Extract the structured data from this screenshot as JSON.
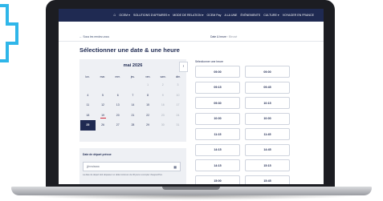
{
  "top_nav": {
    "home_icon": "home-icon",
    "items": [
      {
        "label": "OCEM ▾"
      },
      {
        "label": "SOLUTIONS D'AFFAIRES ▾"
      },
      {
        "label": "MODE DE RELATION ▾"
      },
      {
        "label": "OCEM Pay"
      },
      {
        "label": "A LA UNE"
      },
      {
        "label": "ÉVÉNEMENTS"
      },
      {
        "label": "CULTURE ▾"
      },
      {
        "label": "VOYAGER EN FRANCE"
      }
    ]
  },
  "breadcrumb": {
    "back_label": "← Sous les rendez-vous",
    "step_active": "Date & heure",
    "separator": "›",
    "step_next": "Bleusé"
  },
  "page_title": "Sélectionner une date & une heure",
  "calendar": {
    "month_label": "mai 2026",
    "prev_icon": "chevron-left-icon",
    "next_icon": "chevron-right-icon",
    "weekdays": [
      "lun.",
      "mar.",
      "mer.",
      "jeu.",
      "ven.",
      "sam.",
      "dim."
    ],
    "days": [
      {
        "label": "",
        "state": "empty"
      },
      {
        "label": "",
        "state": "empty"
      },
      {
        "label": "",
        "state": "empty"
      },
      {
        "label": "",
        "state": "empty"
      },
      {
        "label": "1",
        "state": "disabled"
      },
      {
        "label": "2",
        "state": "disabled"
      },
      {
        "label": "3",
        "state": "disabled"
      },
      {
        "label": "4",
        "state": "available"
      },
      {
        "label": "5",
        "state": "available"
      },
      {
        "label": "6",
        "state": "available"
      },
      {
        "label": "7",
        "state": "available"
      },
      {
        "label": "8",
        "state": "available"
      },
      {
        "label": "9",
        "state": "disabled"
      },
      {
        "label": "10",
        "state": "disabled"
      },
      {
        "label": "11",
        "state": "available"
      },
      {
        "label": "12",
        "state": "available"
      },
      {
        "label": "13",
        "state": "available"
      },
      {
        "label": "14",
        "state": "available"
      },
      {
        "label": "15",
        "state": "available"
      },
      {
        "label": "16",
        "state": "disabled"
      },
      {
        "label": "17",
        "state": "disabled"
      },
      {
        "label": "18",
        "state": "available"
      },
      {
        "label": "19",
        "state": "today"
      },
      {
        "label": "20",
        "state": "available"
      },
      {
        "label": "21",
        "state": "available"
      },
      {
        "label": "22",
        "state": "available"
      },
      {
        "label": "23",
        "state": "disabled"
      },
      {
        "label": "24",
        "state": "disabled"
      },
      {
        "label": "25",
        "state": "selected"
      },
      {
        "label": "26",
        "state": "available"
      },
      {
        "label": "27",
        "state": "available"
      },
      {
        "label": "28",
        "state": "available"
      },
      {
        "label": "29",
        "state": "available"
      },
      {
        "label": "30",
        "state": "disabled"
      },
      {
        "label": "31",
        "state": "disabled"
      }
    ]
  },
  "departure": {
    "label": "Date de départ prévue",
    "placeholder": "jj/mm/aaaa",
    "icon": "calendar-icon",
    "note": "La date de départ doit dépasser un délai minimum de 30 jours à compter d'aujourd'hui."
  },
  "times": {
    "label": "Sélectionner une heure",
    "slots": [
      "09:00",
      "09:00",
      "09:15",
      "09:45",
      "09:30",
      "10:15",
      "10:00",
      "10:00",
      "11:15",
      "11:45",
      "14:15",
      "14:45",
      "14:15",
      "15:15",
      "15:00",
      "15:45",
      "16:15",
      "16:45"
    ]
  },
  "colors": {
    "brand_navy": "#1f2a52",
    "accent_blue": "#2fb6e9",
    "today_underline": "#d0283a"
  }
}
